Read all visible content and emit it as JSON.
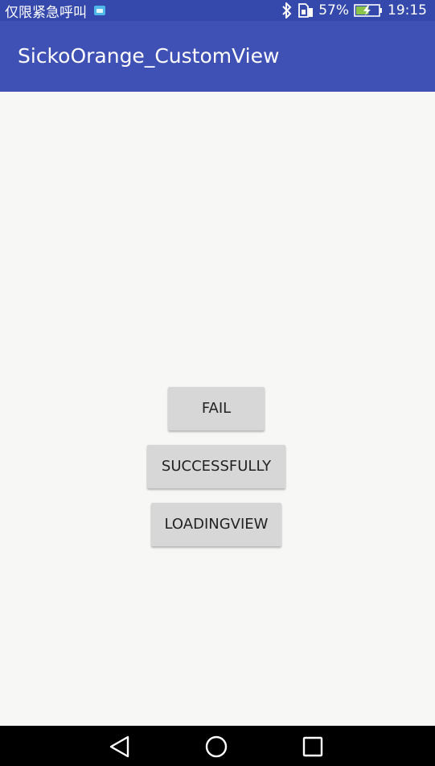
{
  "status_bar": {
    "carrier": "仅限紧急呼叫",
    "notification_icon": "android-debug-icon",
    "bluetooth_icon": "bluetooth-icon",
    "sim_icon": "sim-icon",
    "battery_percent_text": "57%",
    "battery_level": 0.57,
    "time": "19:15"
  },
  "app_bar": {
    "title": "SickoOrange_CustomView"
  },
  "buttons": {
    "fail": "FAIL",
    "successfully": "SUCCESSFULLY",
    "loadingview": "LOADINGVIEW"
  },
  "nav_bar": {
    "back_icon": "back-triangle-icon",
    "home_icon": "home-circle-icon",
    "recent_icon": "recent-square-icon"
  },
  "colors": {
    "primary": "#3f51b5",
    "primary_dark": "#3549ac",
    "background": "#f7f7f5",
    "button": "#d7d7d7",
    "nav_bar": "#000000"
  }
}
